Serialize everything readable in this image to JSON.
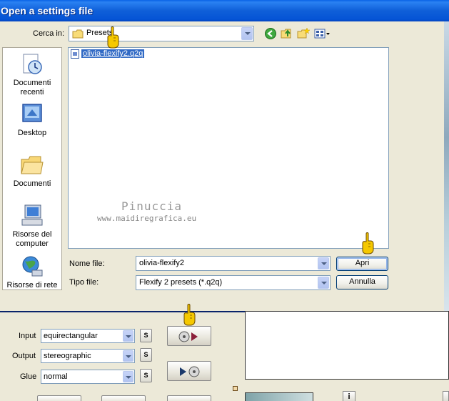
{
  "window": {
    "title": "Open a settings file"
  },
  "lookin": {
    "label": "Cerca in:",
    "value": "Presets"
  },
  "toolbar_icons": [
    "back-icon",
    "up-folder-icon",
    "new-folder-icon",
    "view-menu-icon"
  ],
  "places": [
    {
      "label": "Documenti\nrecenti",
      "icon": "recent-documents-icon"
    },
    {
      "label": "Desktop",
      "icon": "desktop-icon"
    },
    {
      "label": "Documenti",
      "icon": "documents-folder-icon"
    },
    {
      "label": "Risorse del\ncomputer",
      "icon": "my-computer-icon"
    },
    {
      "label": "Risorse di rete",
      "icon": "network-icon"
    }
  ],
  "files": [
    {
      "name": "olivia-flexify2.q2q",
      "selected": true
    }
  ],
  "watermark": {
    "line1": "Pinuccia",
    "line2": "www.maidiregrafica.eu"
  },
  "filename": {
    "label": "Nome file:",
    "value": "olivia-flexify2"
  },
  "filetype": {
    "label": "Tipo file:",
    "value": "Flexify 2 presets (*.q2q)"
  },
  "buttons": {
    "open": "Apri",
    "cancel": "Annulla"
  },
  "plugin": {
    "input": {
      "label": "Input",
      "value": "equirectangular",
      "s": "S"
    },
    "output": {
      "label": "Output",
      "value": "stereographic",
      "s": "S"
    },
    "glue": {
      "label": "Glue",
      "value": "normal",
      "s": "S"
    },
    "info": "i"
  },
  "colors": {
    "titlebar": "#0554d6",
    "selection": "#316ac5",
    "pointer": "#f5c800"
  }
}
